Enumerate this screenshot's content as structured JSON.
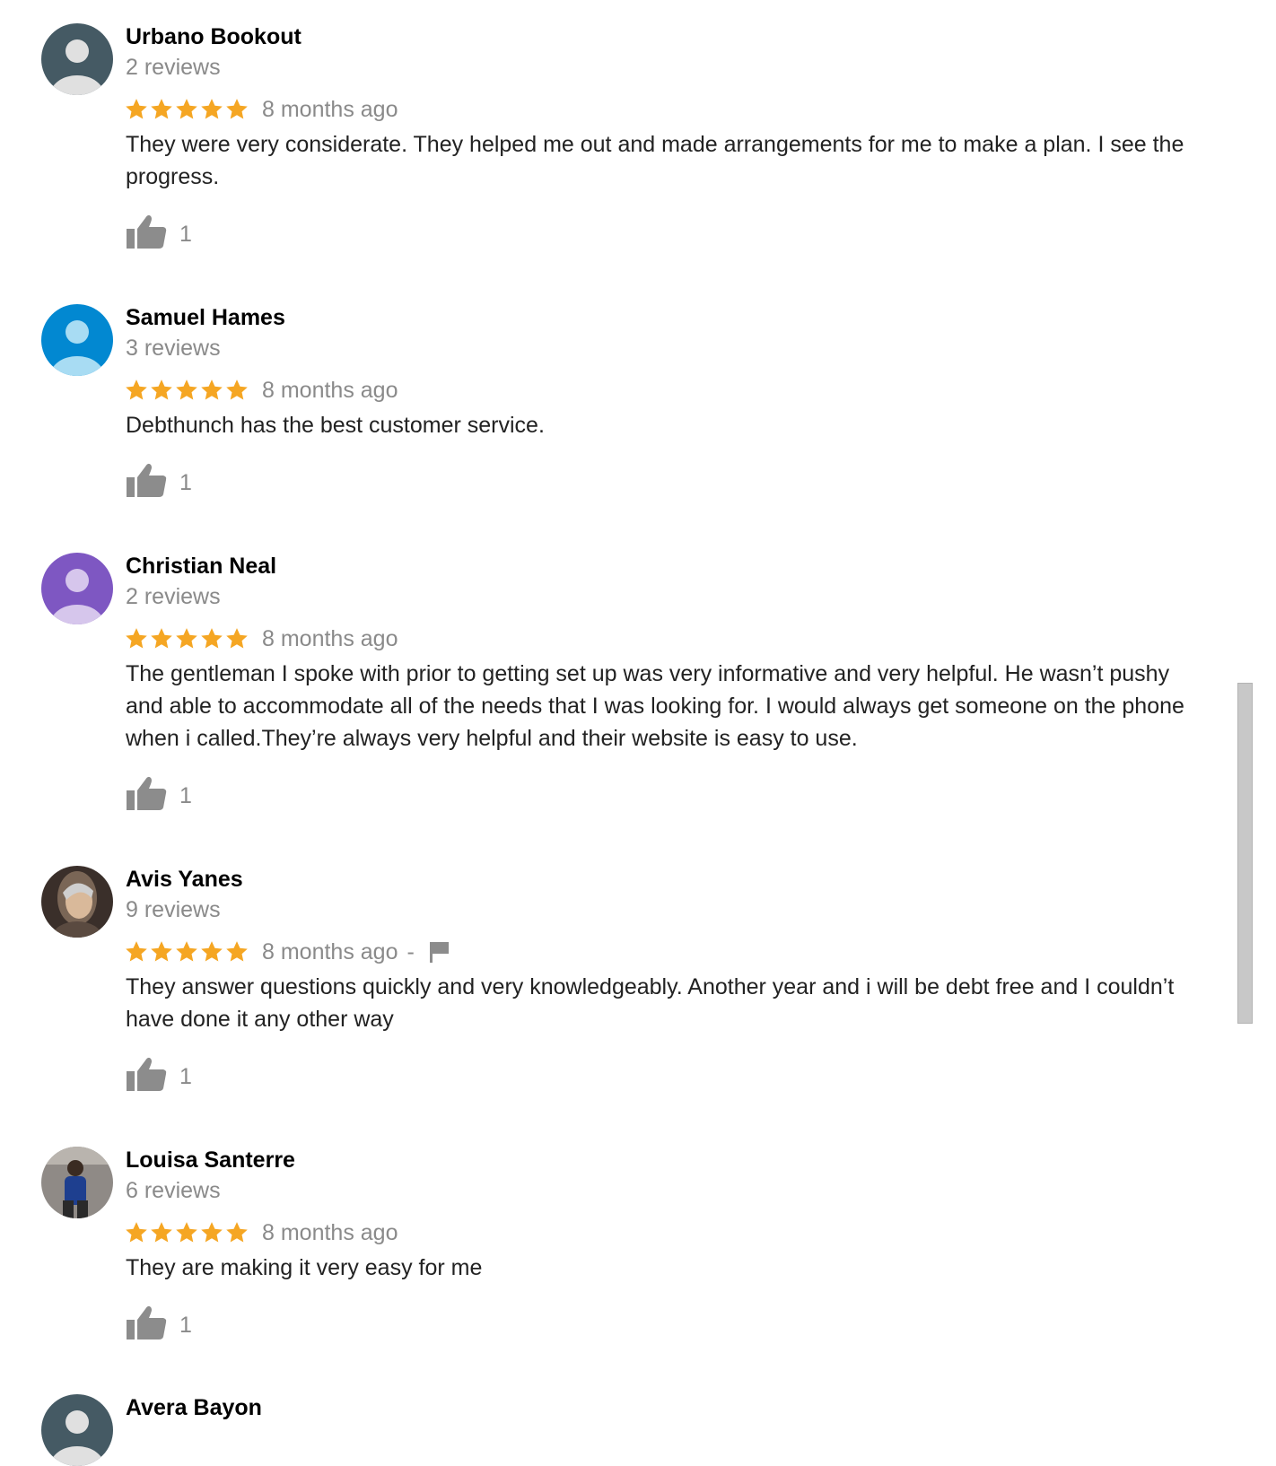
{
  "colors": {
    "star": "#f5a623",
    "muted_text": "#8a8a8a",
    "name_text": "#000000",
    "body_text": "#222222",
    "icon_gray": "#8c8c8c"
  },
  "reviews": [
    {
      "author": "Urbano Bookout",
      "review_count": "2 reviews",
      "rating": 5,
      "date": "8 months ago",
      "text": "They were very considerate. They helped me out and made arrangements for me to make a plan. I see the progress.",
      "likes": "1",
      "avatar": {
        "type": "default-person-icon",
        "bg": "#455a64",
        "fg": "#e0e0e0"
      }
    },
    {
      "author": "Samuel Hames",
      "review_count": "3 reviews",
      "rating": 5,
      "date": "8 months ago",
      "text": "Debthunch has the best customer service.",
      "likes": "1",
      "avatar": {
        "type": "default-person-icon",
        "bg": "#0288d1",
        "fg": "#a8dcf3"
      }
    },
    {
      "author": "Christian Neal",
      "review_count": "2 reviews",
      "rating": 5,
      "date": "8 months ago",
      "text": "The gentleman I spoke with prior to getting set up was very informative and very helpful. He wasn’t pushy and able to accommodate all of the needs that I was looking for. I would always get someone on the phone when i called.They’re always very helpful and their website is easy to use.",
      "likes": "1",
      "avatar": {
        "type": "default-person-icon",
        "bg": "#7e57c2",
        "fg": "#d6c6ec"
      }
    },
    {
      "author": "Avis Yanes",
      "review_count": "9 reviews",
      "rating": 5,
      "date": "8 months ago",
      "separator": "-",
      "flag": "flag-icon",
      "text": "They answer questions quickly and very knowledgeably. Another year and i will be debt free and I couldn’t have done it any other way",
      "likes": "1",
      "avatar": {
        "type": "photo",
        "bg": "#3a2f2a",
        "fg": "#d9b99a"
      }
    },
    {
      "author": "Louisa Santerre",
      "review_count": "6 reviews",
      "rating": 5,
      "date": "8 months ago",
      "text": "They are making it very easy for me",
      "likes": "1",
      "avatar": {
        "type": "photo",
        "bg": "#8f8a86",
        "fg": "#1e3f8f"
      }
    },
    {
      "author": "Avera Bayon",
      "avatar": {
        "type": "default-person-icon",
        "bg": "#455a64",
        "fg": "#e0e0e0"
      }
    }
  ]
}
